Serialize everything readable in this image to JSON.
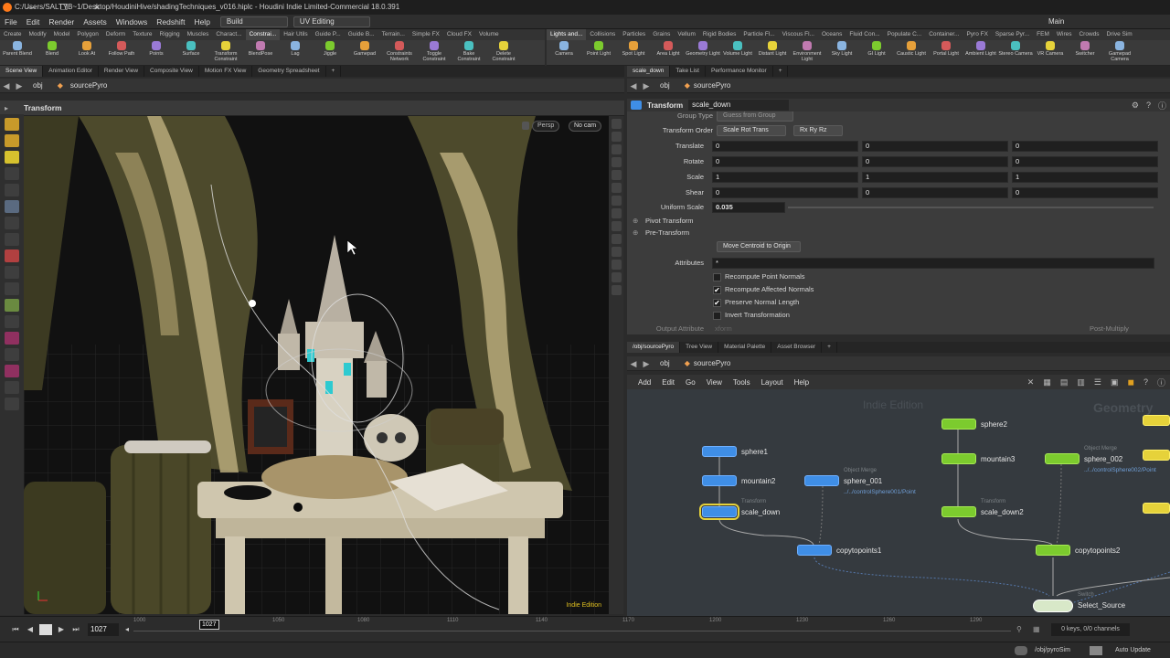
{
  "window": {
    "title": "C:/Users/SALTYB~1/Desktop/HoudiniHive/shadingTechniques_v016.hiplc - Houdini Indie Limited-Commercial 18.0.391",
    "controls": [
      "—",
      "❐",
      "✕"
    ]
  },
  "menubar": {
    "items": [
      "File",
      "Edit",
      "Render",
      "Assets",
      "Windows",
      "Redshift",
      "Help"
    ],
    "desktop": "Build",
    "desktop2": "UV Editing",
    "right_desktop": "Main"
  },
  "shelf_left": {
    "tabs": [
      "Create",
      "Modify",
      "Model",
      "Polygon",
      "Deform",
      "Texture",
      "Rigging",
      "Muscles",
      "Charact...",
      "Constrai...",
      "Hair Utils",
      "Guide P...",
      "Guide B...",
      "Terrain...",
      "Simple FX",
      "Cloud FX",
      "Volume"
    ],
    "active_tab": 9,
    "tools": [
      "Parent Blend",
      "Blend",
      "Look At",
      "Follow Path",
      "Points",
      "Surface",
      "Transform Constraint",
      "BlendPose",
      "Lag",
      "Jiggle",
      "Gamepad",
      "Constraints Network",
      "Toggle Constraint",
      "Bake Constraint",
      "Delete Constraint"
    ]
  },
  "shelf_right": {
    "tabs": [
      "Lights and...",
      "Collisions",
      "Particles",
      "Grains",
      "Vellum",
      "Rigid Bodies",
      "Particle Fl...",
      "Viscous Fl...",
      "Oceans",
      "Fluid Con...",
      "Populate C...",
      "Container...",
      "Pyro FX",
      "Sparse Pyr...",
      "FEM",
      "Wires",
      "Crowds",
      "Drive Sim"
    ],
    "active_tab": 0,
    "tools": [
      "Camera",
      "Point Light",
      "Spot Light",
      "Area Light",
      "Geometry Light",
      "Volume Light",
      "Distant Light",
      "Environment Light",
      "Sky Light",
      "GI Light",
      "Caustic Light",
      "Portal Light",
      "Ambient Light",
      "Stereo Camera",
      "VR Camera",
      "Switcher",
      "Gamepad Camera"
    ]
  },
  "left_pane": {
    "tabs": [
      "Scene View",
      "Animation Editor",
      "Render View",
      "Composite View",
      "Motion FX View",
      "Geometry Spreadsheet"
    ],
    "path": [
      "obj",
      "sourcePyro"
    ],
    "tool_title": "Transform",
    "view_menu": "Persp",
    "cam_menu": "No cam",
    "watermark": "Indie Edition"
  },
  "param_pane": {
    "tabs": [
      "scale_down",
      "Take List",
      "Performance Monitor"
    ],
    "path": [
      "obj",
      "sourcePyro"
    ],
    "node_type": "Transform",
    "node_name": "scale_down",
    "group_type_label": "Group Type",
    "group_type_value": "Guess from Group",
    "transform_order_label": "Transform Order",
    "transform_order_value": "Scale Rot Trans",
    "rotate_order_value": "Rx Ry Rz",
    "vectors": [
      {
        "label": "Translate",
        "x": "0",
        "y": "0",
        "z": "0"
      },
      {
        "label": "Rotate",
        "x": "0",
        "y": "0",
        "z": "0"
      },
      {
        "label": "Scale",
        "x": "1",
        "y": "1",
        "z": "1"
      },
      {
        "label": "Shear",
        "x": "0",
        "y": "0",
        "z": "0"
      }
    ],
    "uniform_scale_label": "Uniform Scale",
    "uniform_scale_value": "0.035",
    "pivot_transform": "Pivot Transform",
    "pre_transform": "Pre-Transform",
    "move_centroid": "Move Centroid to Origin",
    "attributes_label": "Attributes",
    "attributes_value": "*",
    "checkboxes": [
      {
        "label": "Recompute Point Normals",
        "checked": false
      },
      {
        "label": "Recompute Affected Normals",
        "checked": true
      },
      {
        "label": "Preserve Normal Length",
        "checked": true
      },
      {
        "label": "Invert Transformation",
        "checked": false
      }
    ],
    "output_attribute_label": "Output Attribute",
    "output_attribute_value": "xform",
    "post_multiply": "Post-Multiply"
  },
  "network_pane": {
    "tabs": [
      "/obj/sourcePyro",
      "Tree View",
      "Material Palette",
      "Asset Browser"
    ],
    "path": [
      "obj",
      "sourcePyro"
    ],
    "menu": [
      "Add",
      "Edit",
      "Go",
      "View",
      "Tools",
      "Layout",
      "Help"
    ],
    "watermark_indie": "Indie Edition",
    "watermark_geo": "Geometry",
    "nodes": {
      "sphere1": "sphere1",
      "mountain2": "mountain2",
      "scale_down": "scale_down",
      "scale_down_type": "Transform",
      "sphere_001": "sphere_001",
      "sphere_001_type": "Object Merge",
      "sphere_001_path": "../../controlSphere001/Point",
      "copytopoints1": "copytopoints1",
      "sphere2": "sphere2",
      "mountain3": "mountain3",
      "sphere_002": "sphere_002",
      "sphere_002_type": "Object Merge",
      "sphere_002_path": "../../controlSphere002/Point",
      "scale_down2": "scale_down2",
      "scale_down2_type": "Transform",
      "copytopoints2": "copytopoints2",
      "select_source": "Select_Source",
      "select_source_type": "Switch"
    }
  },
  "timeline": {
    "frame_field": "1027",
    "current_marker": "1027",
    "ticks": [
      "1000",
      "1050",
      "1080",
      "1110",
      "1140",
      "1170",
      "1200",
      "1230",
      "1260",
      "1290"
    ],
    "keys_info": "0 keys, 0/0 channels"
  },
  "statusbar": {
    "path": "/obj/pyroSim",
    "auto_update": "Auto Update"
  },
  "colors": {
    "accent_orange": "#ff7a1a",
    "node_blue": "#3f8ee6",
    "node_green": "#7ccb2e",
    "node_yellow": "#e6d23a"
  }
}
